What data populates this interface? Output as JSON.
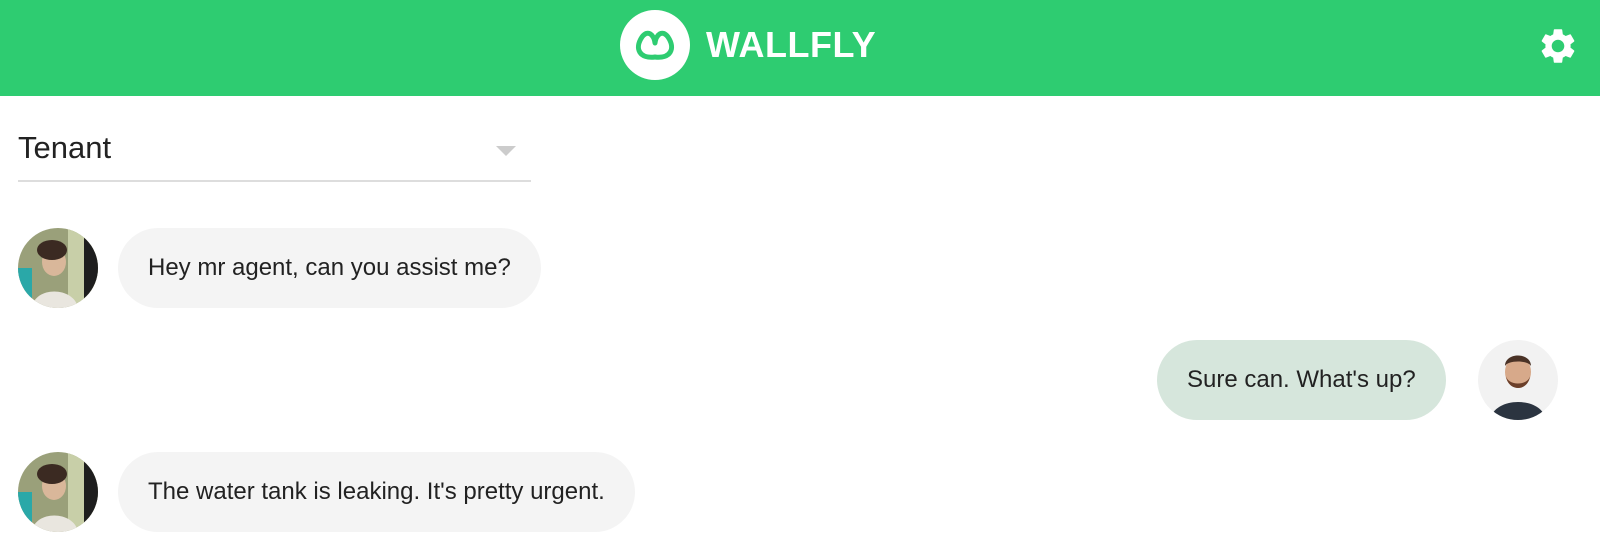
{
  "header": {
    "brand": "WALLFLY",
    "accent_color": "#2ecc71",
    "logo_icon": "wallfly-logo-icon",
    "settings_icon": "gear-icon"
  },
  "role_select": {
    "value": "Tenant"
  },
  "messages": [
    {
      "sender": "tenant",
      "direction": "incoming",
      "text": "Hey mr agent, can you assist me?"
    },
    {
      "sender": "agent",
      "direction": "outgoing",
      "text": "Sure can. What's up?"
    },
    {
      "sender": "tenant",
      "direction": "incoming",
      "text": "The water tank is leaking. It's pretty urgent."
    }
  ]
}
